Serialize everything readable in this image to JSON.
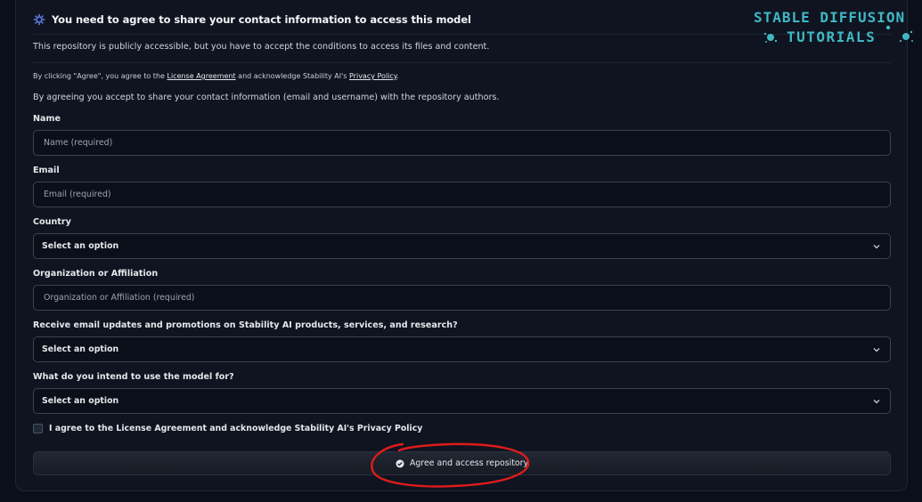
{
  "header": {
    "title": "You need to agree to share your contact information to access this model",
    "icon": "gear-icon"
  },
  "intro": "This repository is publicly accessible, but you have to accept the conditions to access its files and content.",
  "notice": {
    "prefix": "By clicking \"Agree\", you agree to the ",
    "license_link": "License Agreement",
    "middle": " and acknowledge Stability AI's ",
    "privacy_link": "Privacy Policy",
    "suffix": "."
  },
  "share_text": "By agreeing you accept to share your contact information (email and username) with the repository authors.",
  "form": {
    "name": {
      "label": "Name",
      "placeholder": "Name (required)"
    },
    "email": {
      "label": "Email",
      "placeholder": "Email (required)"
    },
    "country": {
      "label": "Country",
      "value": "Select an option"
    },
    "organization": {
      "label": "Organization or Affiliation",
      "placeholder": "Organization or Affiliation (required)"
    },
    "updates": {
      "label": "Receive email updates and promotions on Stability AI products, services, and research?",
      "value": "Select an option"
    },
    "intent": {
      "label": "What do you intend to use the model for?",
      "value": "Select an option"
    },
    "agree_checkbox": {
      "label": "I agree to the License Agreement and acknowledge Stability AI's Privacy Policy",
      "checked": false
    }
  },
  "submit": {
    "label": "Agree and access repository",
    "icon": "check-circle-icon"
  },
  "watermark": {
    "line1": "STABLE DIFFUSION",
    "line2": "TUTORIALS",
    "color": "#3fb8c4"
  },
  "annotation": {
    "color": "#e01b1b"
  }
}
